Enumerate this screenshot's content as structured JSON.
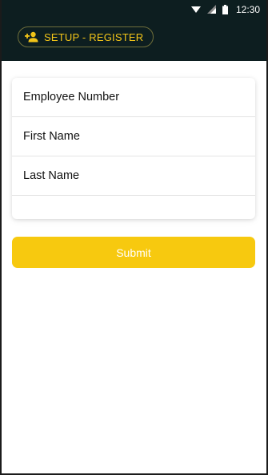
{
  "status_bar": {
    "time": "12:30",
    "icons": [
      "wifi-icon",
      "signal-icon",
      "battery-icon"
    ]
  },
  "app_bar": {
    "title": "SETUP - REGISTER",
    "icon": "add-person-icon",
    "accent_color": "#f2c418",
    "background_color": "#0d1e20"
  },
  "form": {
    "fields": [
      {
        "label": "Employee Number"
      },
      {
        "label": "First Name"
      },
      {
        "label": "Last Name"
      }
    ],
    "submit_label": "Submit",
    "submit_color": "#f7c90f"
  }
}
